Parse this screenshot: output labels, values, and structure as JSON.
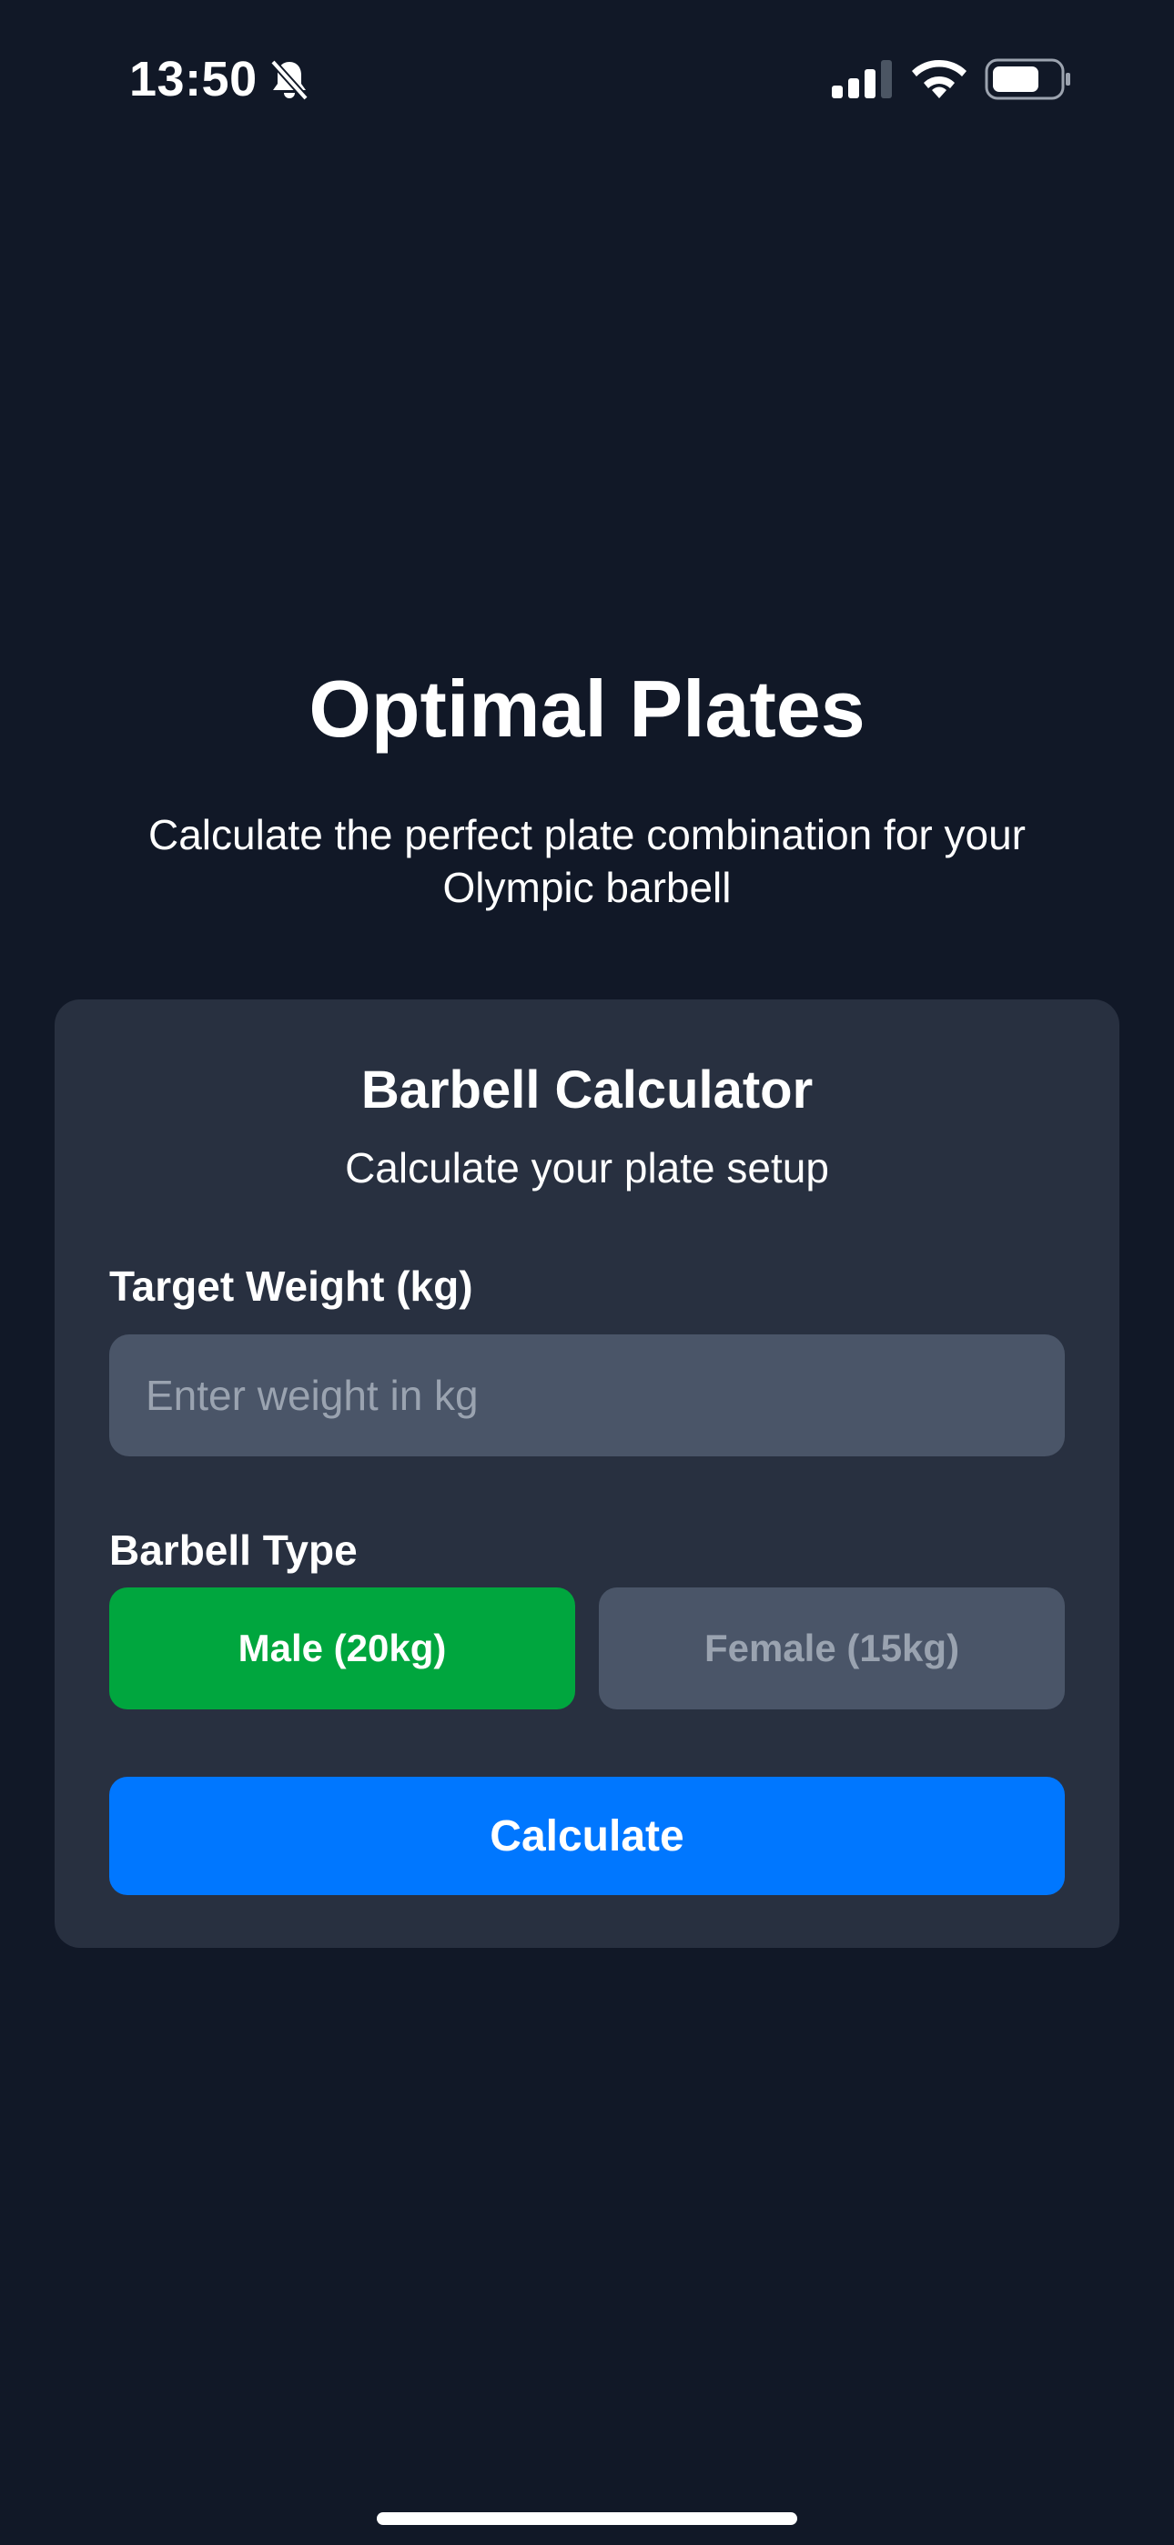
{
  "status_bar": {
    "time": "13:50",
    "icons": [
      "bell-slash-icon",
      "cellular-signal-icon",
      "wifi-icon",
      "battery-icon"
    ]
  },
  "header": {
    "title": "Optimal Plates",
    "subtitle": "Calculate the perfect plate combination for your Olympic barbell"
  },
  "calculator": {
    "title": "Barbell Calculator",
    "subtitle": "Calculate your plate setup",
    "weight_label": "Target Weight (kg)",
    "weight_value": "",
    "weight_placeholder": "Enter weight in kg",
    "type_label": "Barbell Type",
    "options": [
      {
        "label": "Male (20kg)",
        "selected": true
      },
      {
        "label": "Female (15kg)",
        "selected": false
      }
    ],
    "calculate_label": "Calculate"
  },
  "colors": {
    "background": "#111827",
    "card": "#283040",
    "input": "#4a5568",
    "selected": "#00a63e",
    "primary": "#0077ff"
  }
}
